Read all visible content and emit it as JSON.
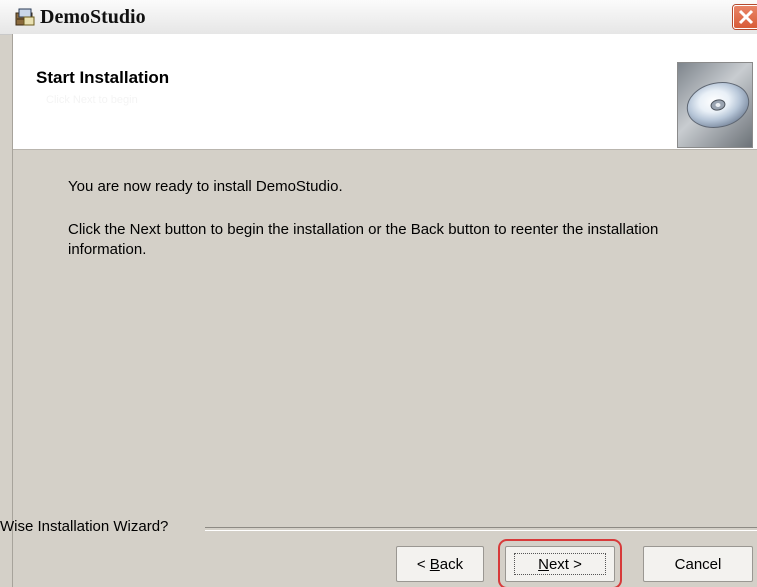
{
  "window": {
    "title": "DemoStudio"
  },
  "header": {
    "title": "Start Installation",
    "subtitle": "Click Next to begin"
  },
  "body": {
    "line1": "You are now ready to install DemoStudio.",
    "line2": "Click the Next button to begin the installation or the Back button to reenter the installation information."
  },
  "footer": {
    "label": "Wise Installation Wizard?"
  },
  "buttons": {
    "back": {
      "prefix": "< ",
      "accel": "B",
      "rest": "ack"
    },
    "next": {
      "accel": "N",
      "rest": "ext >"
    },
    "cancel": {
      "label": "Cancel"
    }
  },
  "colors": {
    "dialog_bg": "#d4d0c8",
    "close_red": "#d85c38",
    "highlight_red": "#d73a3a"
  },
  "icons": {
    "title": "installer-icon",
    "header": "cd-disc-icon",
    "close": "close-icon"
  }
}
